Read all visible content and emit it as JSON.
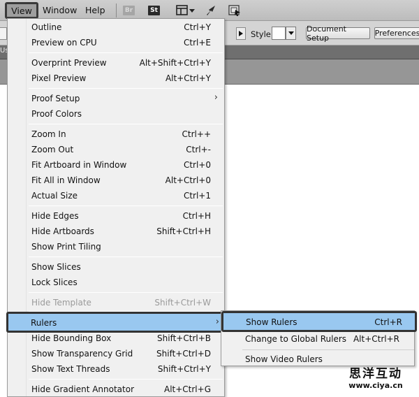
{
  "menubar": {
    "items": [
      {
        "label": "View"
      },
      {
        "label": "Window"
      },
      {
        "label": "Help"
      }
    ],
    "bridge_badge": "Br",
    "stock_badge": "St",
    "icons": [
      "arrange-documents-icon",
      "dropdown-caret-icon",
      "gpu-rocket-icon",
      "sync-settings-icon"
    ]
  },
  "controlbar": {
    "style_label": "Style:",
    "document_setup_label": "Document Setup",
    "preferences_label": "Preferences"
  },
  "tabstrip": {
    "tab_stub": "Us"
  },
  "view_menu": {
    "groups": [
      [
        {
          "label": "Outline",
          "shortcut": "Ctrl+Y"
        },
        {
          "label": "Preview on CPU",
          "shortcut": "Ctrl+E"
        }
      ],
      [
        {
          "label": "Overprint Preview",
          "shortcut": "Alt+Shift+Ctrl+Y"
        },
        {
          "label": "Pixel Preview",
          "shortcut": "Alt+Ctrl+Y"
        }
      ],
      [
        {
          "label": "Proof Setup",
          "shortcut": "",
          "submenu": true
        },
        {
          "label": "Proof Colors",
          "shortcut": ""
        }
      ],
      [
        {
          "label": "Zoom In",
          "shortcut": "Ctrl++"
        },
        {
          "label": "Zoom Out",
          "shortcut": "Ctrl+-"
        },
        {
          "label": "Fit Artboard in Window",
          "shortcut": "Ctrl+0"
        },
        {
          "label": "Fit All in Window",
          "shortcut": "Alt+Ctrl+0"
        },
        {
          "label": "Actual Size",
          "shortcut": "Ctrl+1"
        }
      ],
      [
        {
          "label": "Hide Edges",
          "shortcut": "Ctrl+H"
        },
        {
          "label": "Hide Artboards",
          "shortcut": "Shift+Ctrl+H"
        },
        {
          "label": "Show Print Tiling",
          "shortcut": ""
        }
      ],
      [
        {
          "label": "Show Slices",
          "shortcut": ""
        },
        {
          "label": "Lock Slices",
          "shortcut": ""
        }
      ],
      [
        {
          "label": "Hide Template",
          "shortcut": "Shift+Ctrl+W",
          "disabled": true
        }
      ],
      [
        {
          "label": "Rulers",
          "shortcut": "",
          "submenu": true,
          "highlighted": true
        },
        {
          "label": "Hide Bounding Box",
          "shortcut": "Shift+Ctrl+B"
        },
        {
          "label": "Show Transparency Grid",
          "shortcut": "Shift+Ctrl+D"
        },
        {
          "label": "Show Text Threads",
          "shortcut": "Shift+Ctrl+Y"
        }
      ],
      [
        {
          "label": "Hide Gradient Annotator",
          "shortcut": "Alt+Ctrl+G"
        }
      ]
    ]
  },
  "rulers_submenu": {
    "items": [
      {
        "label": "Show Rulers",
        "shortcut": "Ctrl+R",
        "highlighted": true
      },
      {
        "label": "Change to Global Rulers",
        "shortcut": "Alt+Ctrl+R"
      },
      {
        "label": "Show Video Rulers",
        "shortcut": ""
      }
    ]
  },
  "watermark": {
    "brand": "思洋互动",
    "url": "www.ciya.cn"
  },
  "colors": {
    "menu_highlight": "#99c8f0",
    "highlight_border": "#333333",
    "menubar_bg": "#c6c6c6",
    "menu_bg": "#f0f0f0",
    "disabled_text": "#9a9a9a"
  }
}
